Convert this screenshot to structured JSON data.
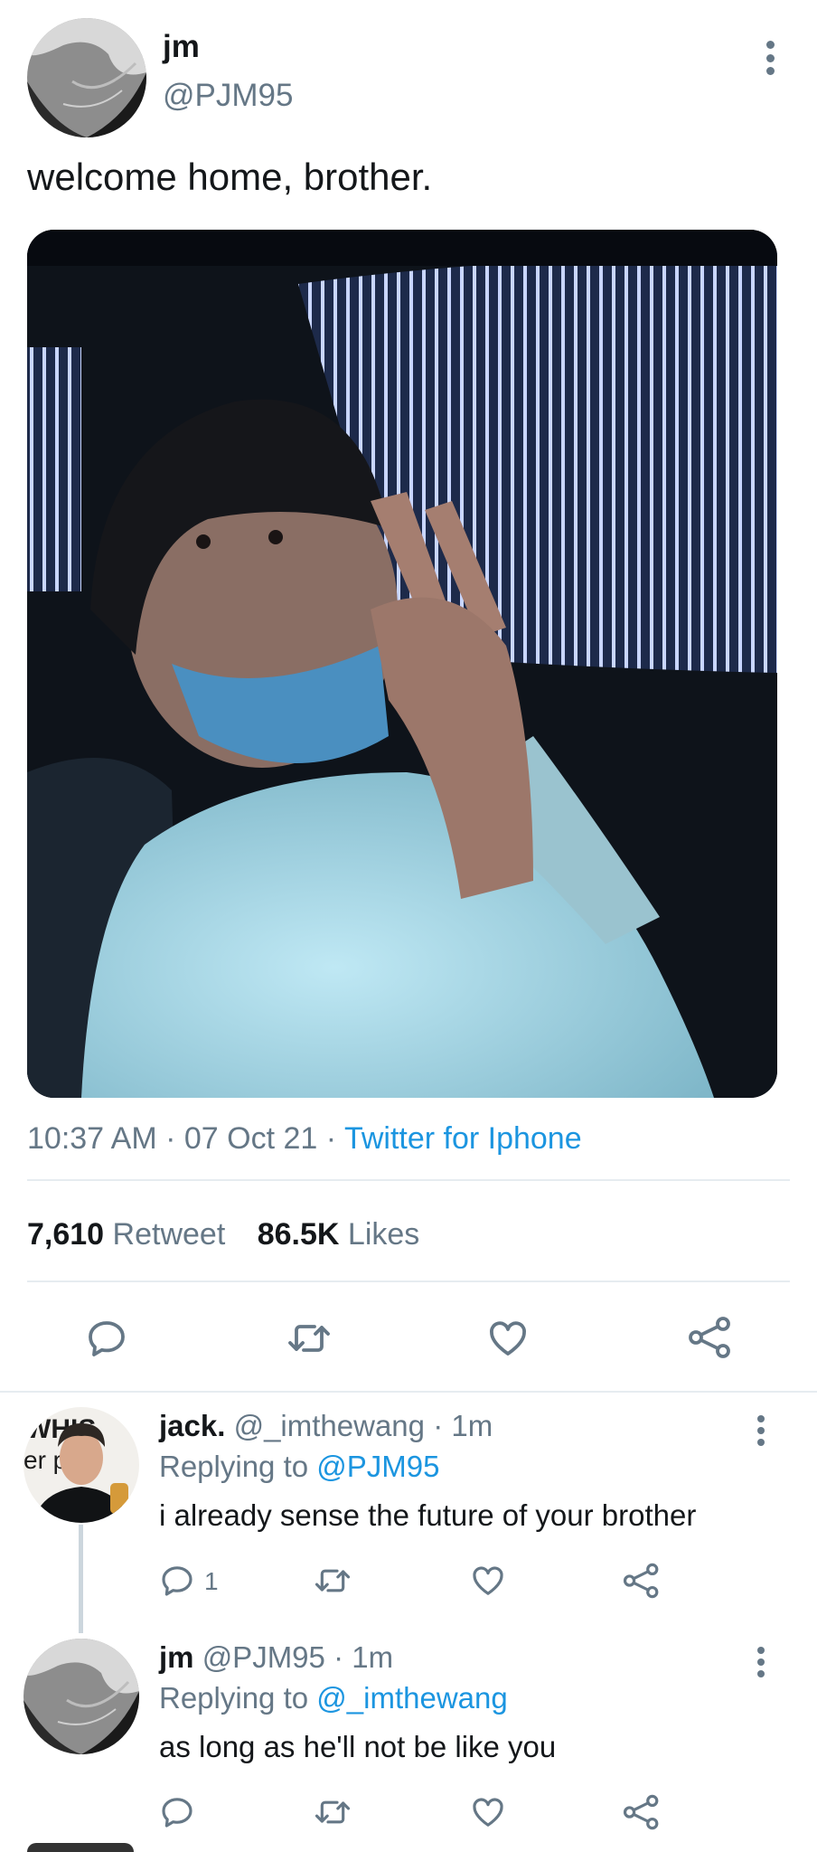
{
  "tweet": {
    "author_name": "jm",
    "author_handle": "@PJM95",
    "text": "welcome home, brother.",
    "time": "10:37 AM",
    "date": "07 Oct 21",
    "separator": "·",
    "source": "Twitter for Iphone",
    "retweets_count": "7,610",
    "retweets_label": "Retweet",
    "likes_count": "86.5K",
    "likes_label": "Likes"
  },
  "replies": [
    {
      "name": "jack.",
      "handle": "@_imthewang",
      "time": "· 1m",
      "replying_label": "Replying to",
      "replying_to": "@PJM95",
      "text": "i already sense the future of your brother",
      "reply_count": "1",
      "avatar_sign_text_1": "WHIS",
      "avatar_sign_text_2": "er  pula"
    },
    {
      "name": "jm",
      "handle": "@PJM95",
      "time": "· 1m",
      "replying_label": "Replying to",
      "replying_to": "@_imthewang",
      "text": "as long as he'll not be like you"
    }
  ],
  "icons": {
    "reply": "reply-icon",
    "retweet": "retweet-icon",
    "like": "heart-icon",
    "share": "share-icon",
    "more": "more-options-icon"
  },
  "colors": {
    "accent": "#1b95e0",
    "secondary_text": "#657786",
    "divider": "#e6ecf0"
  }
}
